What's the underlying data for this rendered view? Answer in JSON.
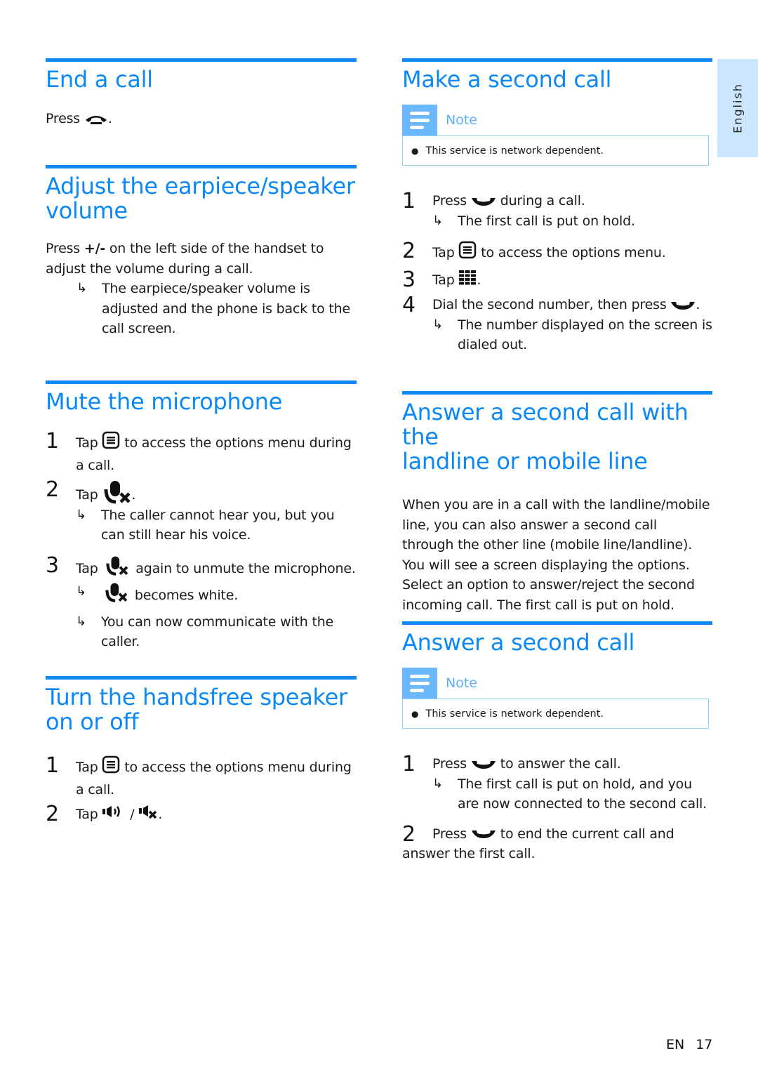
{
  "side_tab": {
    "label": "English",
    "background": "#cde6ff"
  },
  "accent_color": "#0b88f5",
  "left": {
    "end_call": {
      "title": "End a call",
      "text_before": "Press",
      "icon": "hang-up-icon",
      "text_after": "."
    },
    "adjust_volume": {
      "title_line1": "Adjust the earpiece/speaker",
      "title_line2": "volume",
      "text_a": "Press",
      "key": "+/-",
      "text_b": "on the left side of the handset to adjust the volume during a call.",
      "result": "The earpiece/speaker volume is adjusted and the phone is back to the call screen."
    },
    "mute": {
      "title": "Mute the microphone",
      "steps": [
        {
          "num": "1",
          "a": "Tap",
          "icon": "options-menu-icon",
          "b": "to access the options menu during a call."
        },
        {
          "num": "2",
          "a": "Tap",
          "icon": "mute-mic-icon",
          "b": ".",
          "results": [
            "The caller cannot hear you, but you can still hear his voice."
          ]
        },
        {
          "num": "3",
          "a": "Tap",
          "icon": "mute-mic-icon",
          "b": "again to unmute the microphone.",
          "results": [
            "becomes white.",
            "You can now communicate with the caller."
          ]
        }
      ]
    },
    "handsfree": {
      "title_line1": "Turn the handsfree speaker",
      "title_line2": "on or off",
      "steps": [
        {
          "num": "1",
          "a": "Tap",
          "icon": "options-menu-icon",
          "b": "to access the options menu during a call."
        },
        {
          "num": "2",
          "a": "Tap",
          "icon": "speaker-on-icon",
          "sep": "/",
          "icon2": "speaker-off-icon",
          "b": "."
        }
      ]
    }
  },
  "right": {
    "make_second": {
      "title": "Make a second call",
      "note_label": "Note",
      "note_text": "This service is network dependent.",
      "steps": [
        {
          "num": "1",
          "a": "Press",
          "icon": "call-icon",
          "b": "during a call.",
          "results": [
            "The first call is put on hold."
          ]
        },
        {
          "num": "2",
          "a": "Tap",
          "icon": "options-menu-icon",
          "b": "to access the options menu."
        },
        {
          "num": "3",
          "a": "Tap",
          "icon": "keypad-icon",
          "b": "."
        },
        {
          "num": "4",
          "a": "Dial the second number, then press",
          "icon": "call-icon",
          "b": ".",
          "results": [
            "The number displayed on the screen is dialed out."
          ]
        }
      ]
    },
    "answer_line": {
      "title_line1": "Answer a second call with the",
      "title_line2": "landline or mobile line",
      "paragraph": "When you are in a call with the landline/mobile line, you can also answer a second call through the other line (mobile line/landline). You will see a screen displaying the options. Select an option to answer/reject the second incoming call. The first call is put on hold."
    },
    "answer_second": {
      "title": "Answer a second call",
      "note_label": "Note",
      "note_text": "This service is network dependent.",
      "steps": [
        {
          "num": "1",
          "a": "Press",
          "icon": "call-icon",
          "b": "to answer the call.",
          "results": [
            "The first call is put on hold, and you are now connected to the second call."
          ]
        },
        {
          "num": "2",
          "a": "Press",
          "icon": "call-icon",
          "b": "to end the current call and answer the first call."
        }
      ]
    }
  },
  "footer": {
    "lang": "EN",
    "page": "17"
  }
}
